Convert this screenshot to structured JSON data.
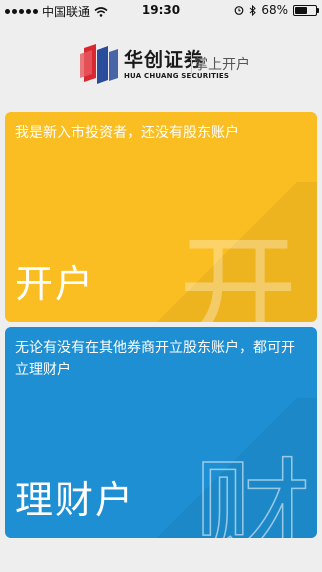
{
  "status_bar": {
    "carrier": "中国联通",
    "time": "19:30",
    "battery": "68%",
    "battery_level": 0.68
  },
  "header": {
    "brand_name": "华创证券",
    "brand_english": "HUA CHUANG SECURITIES",
    "subtitle": "掌上开户"
  },
  "cards": {
    "open": {
      "description": "我是新入市投资者，还没有股东账户",
      "title": "开户",
      "watermark": "开",
      "color": "#fbbe22"
    },
    "manage": {
      "description": "无论有没有在其他券商开立股东账户，都可开立理财户",
      "title": "理财户",
      "watermark": "财",
      "color": "#1d8fd2"
    }
  }
}
